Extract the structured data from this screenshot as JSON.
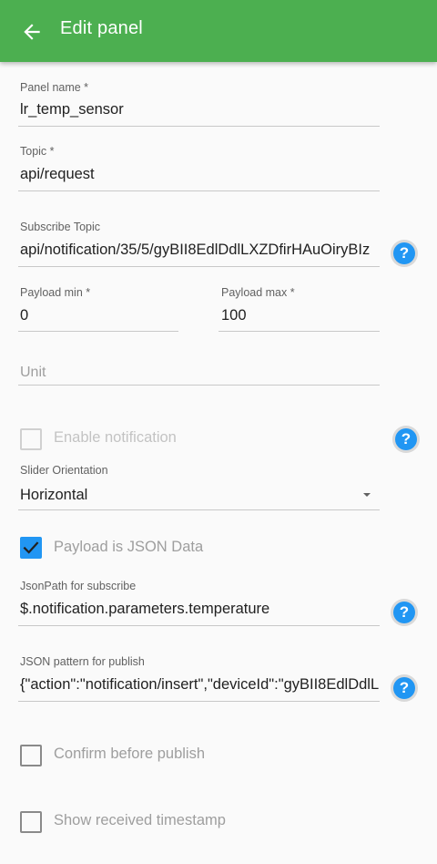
{
  "appbar": {
    "title": "Edit panel",
    "back_icon": "arrow-back-icon",
    "color": "#4caf50"
  },
  "fields": {
    "panel_name": {
      "label": "Panel name *",
      "value": "lr_temp_sensor"
    },
    "topic": {
      "label": "Topic *",
      "value": "api/request"
    },
    "subscribe_topic": {
      "label": "Subscribe Topic",
      "value": "api/notification/35/5/gyBII8EdlDdlLXZDfirHAuOiryBIz"
    },
    "payload_min": {
      "label": "Payload min *",
      "value": "0"
    },
    "payload_max": {
      "label": "Payload max *",
      "value": "100"
    },
    "unit": {
      "placeholder": "Unit"
    },
    "slider_orientation": {
      "label": "Slider Orientation",
      "value": "Horizontal"
    },
    "jsonpath_subscribe": {
      "label": "JsonPath for subscribe",
      "value": "$.notification.parameters.temperature"
    },
    "json_pattern_publish": {
      "label": "JSON pattern for publish",
      "value": "{\"action\":\"notification/insert\",\"deviceId\":\"gyBII8EdlDdlL"
    }
  },
  "checkboxes": {
    "enable_notification": {
      "label": "Enable notification",
      "checked": false,
      "disabled": true
    },
    "payload_is_json": {
      "label": "Payload is JSON Data",
      "checked": true
    },
    "confirm_before_publish": {
      "label": "Confirm before publish",
      "checked": false
    },
    "show_received_timestamp": {
      "label": "Show received timestamp",
      "checked": false
    }
  },
  "help_icon": "help-icon",
  "accent_color": "#2196f3"
}
